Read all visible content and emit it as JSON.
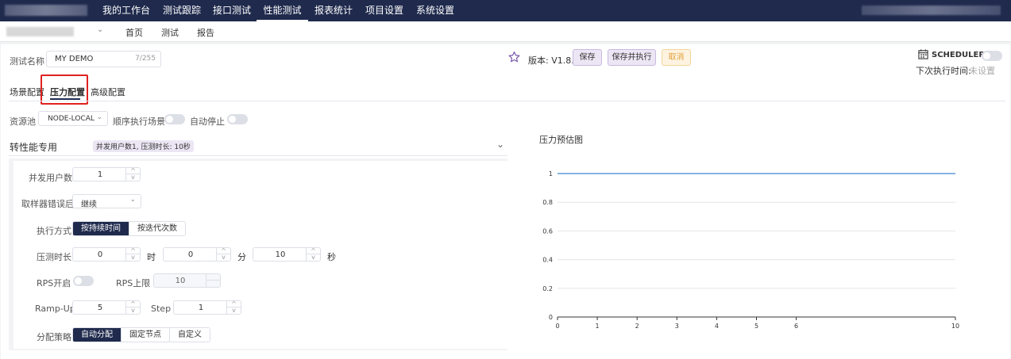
{
  "nav": {
    "items": [
      "我的工作台",
      "测试跟踪",
      "接口测试",
      "性能测试",
      "报表统计",
      "项目设置",
      "系统设置"
    ],
    "active_index": 3
  },
  "subnav": {
    "links": [
      "首页",
      "测试",
      "报告"
    ]
  },
  "test": {
    "name_label": "测试名称",
    "name_value": "MY DEMO",
    "name_count": "7/255",
    "version_label": "版本: V1.8.0",
    "save_label": "保存",
    "save_run_label": "保存并执行",
    "cancel_label": "取消"
  },
  "scheduler": {
    "label": "SCHEDULER",
    "next_label": "下次执行时间:",
    "next_value": "未设置"
  },
  "tabs": [
    "场景配置",
    "压力配置",
    "高级配置"
  ],
  "active_tab": 1,
  "pool": {
    "label": "资源池",
    "value": "NODE-LOCAL",
    "seq_label": "顺序执行场景",
    "auto_stop_label": "自动停止"
  },
  "scenario": {
    "title": "转性能专用",
    "tag": "并发用户数1, 压测时长: 10秒"
  },
  "form": {
    "users_label": "并发用户数",
    "users_value": "1",
    "on_error_label": "取样器错误后",
    "on_error_value": "继续",
    "mode_label": "执行方式",
    "mode_options": [
      "按持续时间",
      "按迭代次数"
    ],
    "mode_selected": 0,
    "duration_label": "压测时长",
    "hours_value": "0",
    "hours_unit": "时",
    "minutes_value": "0",
    "minutes_unit": "分",
    "seconds_value": "10",
    "seconds_unit": "秒",
    "rps_label": "RPS开启",
    "rps_limit_label": "RPS上限",
    "rps_limit_value": "10",
    "rampup_label": "Ramp-Up",
    "rampup_value": "5",
    "step_label": "Step",
    "step_value": "1",
    "strategy_label": "分配策略",
    "strategy_options": [
      "自动分配",
      "固定节点",
      "自定义"
    ],
    "strategy_selected": 0
  },
  "icons": {
    "star": "star-icon",
    "calendar": "calendar-icon",
    "chevron": "chevron-down-icon"
  },
  "colors": {
    "nav_bg": "#1f2a4d",
    "accent": "#1f2a4d",
    "line": "#5b9bd5",
    "highlight": "#e02020"
  },
  "chart_data": {
    "type": "line",
    "title": "压力预估图",
    "x": [
      0,
      10
    ],
    "series": [
      {
        "values": [
          1,
          1
        ]
      }
    ],
    "xlim": [
      0,
      10
    ],
    "ylim": [
      0,
      1
    ],
    "xticks": [
      0,
      1,
      2,
      3,
      4,
      5,
      6,
      10
    ],
    "yticks": [
      0,
      0.2,
      0.4,
      0.6,
      0.8,
      1
    ],
    "grid": true
  }
}
